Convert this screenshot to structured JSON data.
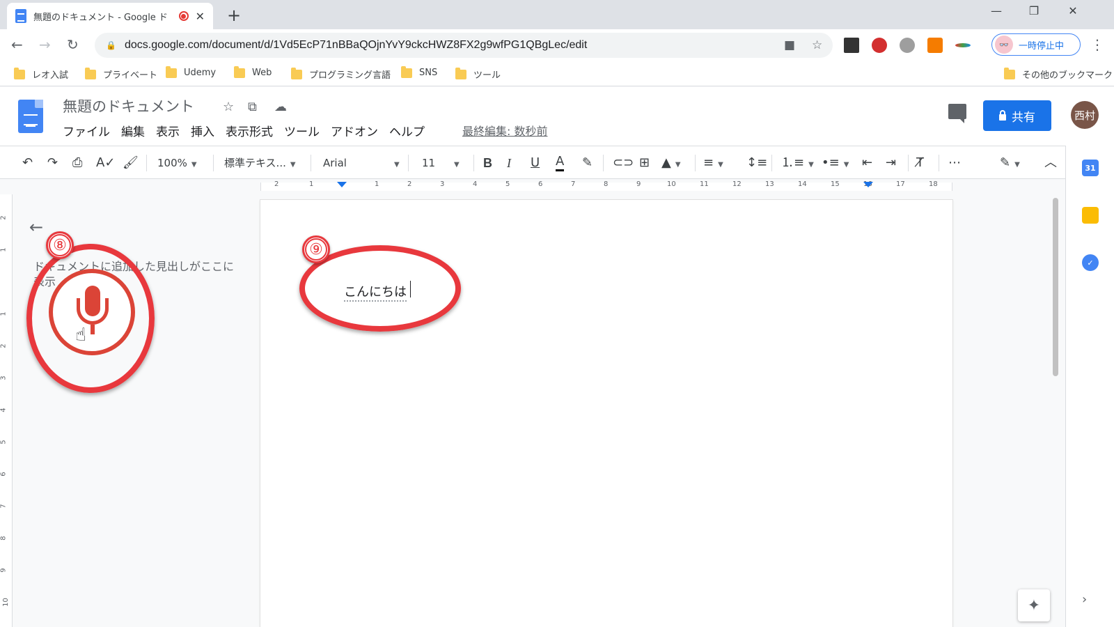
{
  "browser": {
    "tab_title": "無題のドキュメント - Google ド",
    "url": "docs.google.com/document/d/1Vd5EcP71nBBaQOjnYvY9ckcHWZ8FX2g9wfPG1QBgLec/edit",
    "profile_label": "一時停止中",
    "bookmarks": [
      "レオ入試",
      "プライベート",
      "Udemy",
      "Web",
      "プログラミング言語",
      "SNS",
      "ツール"
    ],
    "other_bookmarks": "その他のブックマーク"
  },
  "docs": {
    "title": "無題のドキュメント",
    "menu": [
      "ファイル",
      "編集",
      "表示",
      "挿入",
      "表示形式",
      "ツール",
      "アドオン",
      "ヘルプ"
    ],
    "last_edit": "最終編集: 数秒前",
    "share_label": "共有",
    "avatar_label": "西村",
    "side_calendar_label": "31"
  },
  "toolbar": {
    "zoom": "100%",
    "style": "標準テキス...",
    "font": "Arial",
    "font_size": "11"
  },
  "ruler": {
    "horizontal": [
      "2",
      "1",
      "1",
      "2",
      "3",
      "4",
      "5",
      "6",
      "7",
      "8",
      "9",
      "10",
      "11",
      "12",
      "13",
      "14",
      "15",
      "16",
      "17",
      "18"
    ],
    "vertical": [
      "2",
      "1",
      "1",
      "2",
      "3",
      "4",
      "5",
      "6",
      "7",
      "8",
      "9",
      "10"
    ]
  },
  "outline": {
    "hint": "ドキュメントに追加した見出しがここに表示"
  },
  "document": {
    "text": "こんにちは"
  },
  "annotations": {
    "mic_label": "⑧",
    "text_label": "⑨"
  },
  "colors": {
    "accent": "#1a73e8",
    "annotation": "#e8383d",
    "mic": "#db4437"
  }
}
